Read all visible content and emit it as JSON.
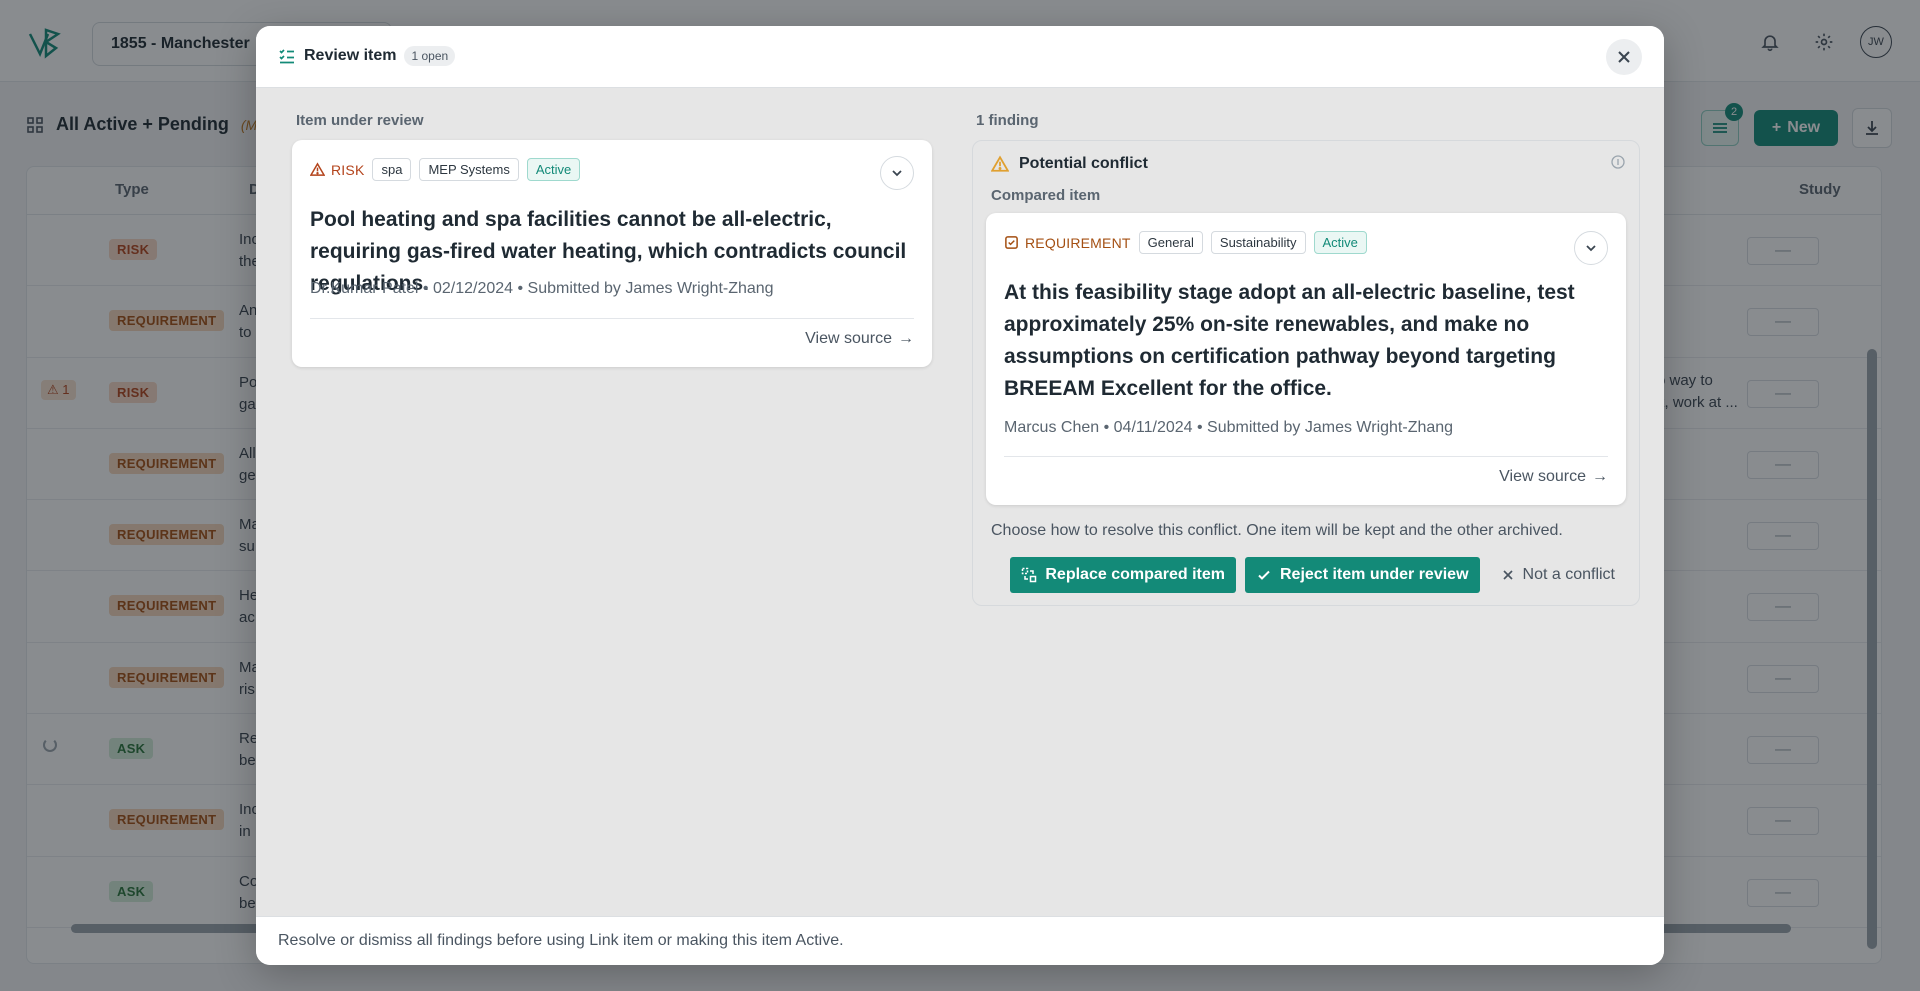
{
  "app": {
    "project": "1855 - Manchester",
    "avatar_initials": "JW"
  },
  "toolbar": {
    "view_title": "All Active + Pending",
    "view_sub": "(Mo",
    "filter_count": "2",
    "new_label": "New"
  },
  "table": {
    "columns": {
      "type": "Type",
      "d": "D",
      "study": "Study"
    },
    "rows": [
      {
        "type": "RISK",
        "kind": "risk",
        "text1": "Inc",
        "text2": "the",
        "flag": "",
        "spinner": false,
        "dash": "—"
      },
      {
        "type": "REQUIREMENT",
        "kind": "req",
        "text1": "An",
        "text2": "to",
        "flag": "",
        "spinner": false,
        "dash": "—"
      },
      {
        "type": "RISK",
        "kind": "risk",
        "text1": "Po",
        "text2": "ga",
        "flag": "1",
        "spinner": false,
        "dash": "—",
        "side1": "o way to",
        "side2": "k, work at ..."
      },
      {
        "type": "REQUIREMENT",
        "kind": "req",
        "text1": "All",
        "text2": "ge",
        "flag": "",
        "spinner": false,
        "dash": "—"
      },
      {
        "type": "REQUIREMENT",
        "kind": "req",
        "text1": "Ma",
        "text2": "su",
        "flag": "",
        "spinner": false,
        "dash": "—"
      },
      {
        "type": "REQUIREMENT",
        "kind": "req",
        "text1": "He",
        "text2": "ac",
        "flag": "",
        "spinner": false,
        "dash": "—"
      },
      {
        "type": "REQUIREMENT",
        "kind": "req",
        "text1": "Ma",
        "text2": "ris",
        "flag": "",
        "spinner": false,
        "dash": "—"
      },
      {
        "type": "ASK",
        "kind": "ask",
        "text1": "Re",
        "text2": "be",
        "flag": "",
        "spinner": true,
        "dash": "—"
      },
      {
        "type": "REQUIREMENT",
        "kind": "req",
        "text1": "Inc",
        "text2": "in",
        "flag": "",
        "spinner": false,
        "dash": "—"
      },
      {
        "type": "ASK",
        "kind": "ask",
        "text1": "Co",
        "text2": "be",
        "flag": "",
        "spinner": false,
        "dash": "—"
      }
    ]
  },
  "modal": {
    "title": "Review item",
    "open_badge": "1 open",
    "left_label": "Item under review",
    "right_label": "1 finding",
    "review_item": {
      "type": "RISK",
      "tags": [
        "spa",
        "MEP Systems"
      ],
      "status": "Active",
      "body": "Pool heating and spa facilities cannot be all-electric, requiring gas-fired water heating, which contradicts council regulations.",
      "meta": "Dr.Kumar Patel • 02/12/2024 • Submitted by James Wright-Zhang",
      "view_source": "View source"
    },
    "finding": {
      "title": "Potential conflict",
      "compared_label": "Compared item",
      "compared_item": {
        "type": "REQUIREMENT",
        "tags": [
          "General",
          "Sustainability"
        ],
        "status": "Active",
        "body": "At this feasibility stage adopt an all-electric baseline, test approximately 25% on-site renewables, and make no assumptions on certification pathway beyond targeting BREEAM Excellent for the office.",
        "meta": "Marcus Chen • 04/11/2024 • Submitted by James Wright-Zhang",
        "view_source": "View source"
      },
      "resolve_text": "Choose how to resolve this conflict. One item will be kept and the other archived.",
      "actions": {
        "replace": "Replace compared item",
        "reject": "Reject item under review",
        "dismiss": "Not a conflict"
      }
    },
    "footer_text": "Resolve or dismiss all findings before using Link item or making this item Active."
  },
  "colors": {
    "accent": "#138a78",
    "risk": "#b4441c",
    "requirement": "#a44f12",
    "warning": "#e0a030"
  }
}
